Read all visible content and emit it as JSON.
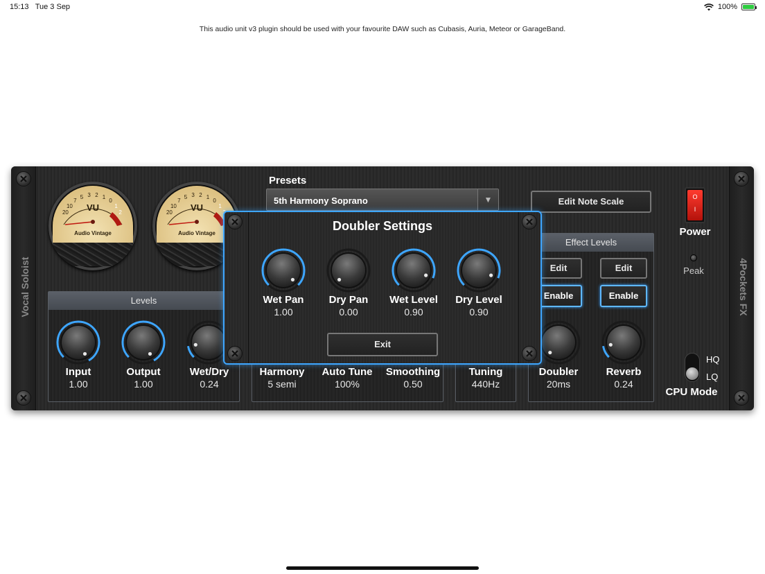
{
  "status_bar": {
    "time": "15:13",
    "date": "Tue 3 Sep",
    "battery": "100%",
    "battery_level": 1.0
  },
  "notice": "This audio unit v3 plugin should be used with your favourite DAW such as Cubasis, Auria, Meteor or GarageBand.",
  "plugin": {
    "left_rail": "Vocal Soloist",
    "right_rail": "4Pockets FX",
    "vu_meters": [
      {
        "label": "VU",
        "brand": "Audio Vintage"
      },
      {
        "label": "VU",
        "brand": "Audio Vintage"
      }
    ],
    "vu_scale": [
      "20",
      "10",
      "7",
      "5",
      "3",
      "2",
      "1",
      "0",
      "1",
      "2"
    ],
    "presets": {
      "label": "Presets",
      "selected": "5th Harmony Soprano"
    },
    "edit_note_scale": "Edit Note Scale",
    "power": {
      "label": "Power",
      "on_mark": "O",
      "off_mark": "I",
      "state": "on"
    },
    "peak_label": "Peak",
    "cpu_mode": {
      "label": "CPU Mode",
      "hq": "HQ",
      "lq": "LQ",
      "selected": "LQ"
    },
    "levels_panel": {
      "title": "Levels",
      "knobs": [
        {
          "label": "Input",
          "value": "1.00"
        },
        {
          "label": "Output",
          "value": "1.00"
        },
        {
          "label": "Wet/Dry",
          "value": "0.24"
        }
      ]
    },
    "harmony_panel": {
      "knobs": [
        {
          "label": "Harmony",
          "value": "5 semi"
        },
        {
          "label": "Auto Tune",
          "value": "100%"
        },
        {
          "label": "Smoothing",
          "value": "0.50"
        }
      ]
    },
    "tuning_panel": {
      "label": "Tuning",
      "value": "440Hz"
    },
    "effect_levels": {
      "title": "Effect Levels",
      "edit_label": "Edit",
      "enable_label": "Enable",
      "knobs": [
        {
          "label": "Doubler",
          "value": "20ms"
        },
        {
          "label": "Reverb",
          "value": "0.24"
        }
      ]
    }
  },
  "modal": {
    "title": "Doubler Settings",
    "knobs": [
      {
        "label": "Wet Pan",
        "value": "1.00"
      },
      {
        "label": "Dry Pan",
        "value": "0.00"
      },
      {
        "label": "Wet Level",
        "value": "0.90"
      },
      {
        "label": "Dry Level",
        "value": "0.90"
      }
    ],
    "exit_label": "Exit"
  },
  "colors": {
    "accent": "#3ea6ff",
    "power_red": "#e8261b",
    "chassis": "#2a2a2a"
  }
}
